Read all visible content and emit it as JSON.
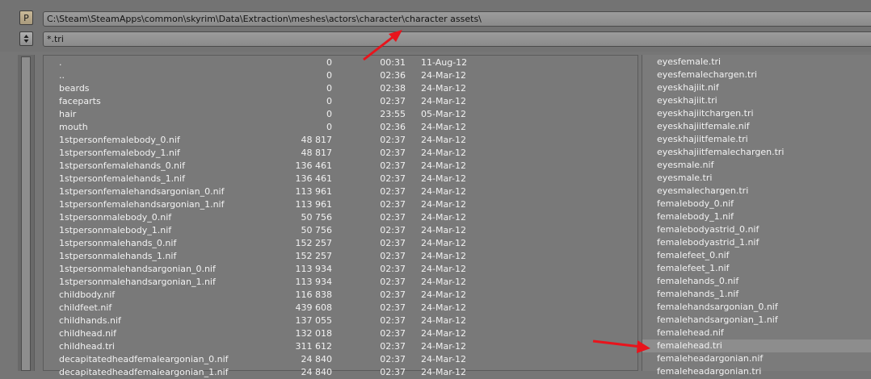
{
  "toolbar": {
    "parent_button_label": "P",
    "path": "C:\\Steam\\SteamApps\\common\\skyrim\\Data\\Extraction\\meshes\\actors\\character\\character assets\\",
    "filter": "*.tri"
  },
  "left_list": [
    {
      "name": ".",
      "size": "0",
      "time": "00:31",
      "date": "11-Aug-12"
    },
    {
      "name": "..",
      "size": "0",
      "time": "02:36",
      "date": "24-Mar-12"
    },
    {
      "name": "beards",
      "size": "0",
      "time": "02:38",
      "date": "24-Mar-12"
    },
    {
      "name": "faceparts",
      "size": "0",
      "time": "02:37",
      "date": "24-Mar-12"
    },
    {
      "name": "hair",
      "size": "0",
      "time": "23:55",
      "date": "05-Mar-12"
    },
    {
      "name": "mouth",
      "size": "0",
      "time": "02:36",
      "date": "24-Mar-12"
    },
    {
      "name": "1stpersonfemalebody_0.nif",
      "size": "48 817",
      "time": "02:37",
      "date": "24-Mar-12"
    },
    {
      "name": "1stpersonfemalebody_1.nif",
      "size": "48 817",
      "time": "02:37",
      "date": "24-Mar-12"
    },
    {
      "name": "1stpersonfemalehands_0.nif",
      "size": "136 461",
      "time": "02:37",
      "date": "24-Mar-12"
    },
    {
      "name": "1stpersonfemalehands_1.nif",
      "size": "136 461",
      "time": "02:37",
      "date": "24-Mar-12"
    },
    {
      "name": "1stpersonfemalehandsargonian_0.nif",
      "size": "113 961",
      "time": "02:37",
      "date": "24-Mar-12"
    },
    {
      "name": "1stpersonfemalehandsargonian_1.nif",
      "size": "113 961",
      "time": "02:37",
      "date": "24-Mar-12"
    },
    {
      "name": "1stpersonmalebody_0.nif",
      "size": "50 756",
      "time": "02:37",
      "date": "24-Mar-12"
    },
    {
      "name": "1stpersonmalebody_1.nif",
      "size": "50 756",
      "time": "02:37",
      "date": "24-Mar-12"
    },
    {
      "name": "1stpersonmalehands_0.nif",
      "size": "152 257",
      "time": "02:37",
      "date": "24-Mar-12"
    },
    {
      "name": "1stpersonmalehands_1.nif",
      "size": "152 257",
      "time": "02:37",
      "date": "24-Mar-12"
    },
    {
      "name": "1stpersonmalehandsargonian_0.nif",
      "size": "113 934",
      "time": "02:37",
      "date": "24-Mar-12"
    },
    {
      "name": "1stpersonmalehandsargonian_1.nif",
      "size": "113 934",
      "time": "02:37",
      "date": "24-Mar-12"
    },
    {
      "name": "childbody.nif",
      "size": "116 838",
      "time": "02:37",
      "date": "24-Mar-12"
    },
    {
      "name": "childfeet.nif",
      "size": "439 608",
      "time": "02:37",
      "date": "24-Mar-12"
    },
    {
      "name": "childhands.nif",
      "size": "137 055",
      "time": "02:37",
      "date": "24-Mar-12"
    },
    {
      "name": "childhead.nif",
      "size": "132 018",
      "time": "02:37",
      "date": "24-Mar-12"
    },
    {
      "name": "childhead.tri",
      "size": "311 612",
      "time": "02:37",
      "date": "24-Mar-12"
    },
    {
      "name": "decapitatedheadfemaleargonian_0.nif",
      "size": "24 840",
      "time": "02:37",
      "date": "24-Mar-12"
    },
    {
      "name": "decapitatedheadfemaleargonian_1.nif",
      "size": "24 840",
      "time": "02:37",
      "date": "24-Mar-12"
    }
  ],
  "right_list": [
    {
      "name": "eyesfemale.tri"
    },
    {
      "name": "eyesfemalechargen.tri"
    },
    {
      "name": "eyeskhajiit.nif"
    },
    {
      "name": "eyeskhajiit.tri"
    },
    {
      "name": "eyeskhajiitchargen.tri"
    },
    {
      "name": "eyeskhajiitfemale.nif"
    },
    {
      "name": "eyeskhajiitfemale.tri"
    },
    {
      "name": "eyeskhajiitfemalechargen.tri"
    },
    {
      "name": "eyesmale.nif"
    },
    {
      "name": "eyesmale.tri"
    },
    {
      "name": "eyesmalechargen.tri"
    },
    {
      "name": "femalebody_0.nif"
    },
    {
      "name": "femalebody_1.nif"
    },
    {
      "name": "femalebodyastrid_0.nif"
    },
    {
      "name": "femalebodyastrid_1.nif"
    },
    {
      "name": "femalefeet_0.nif"
    },
    {
      "name": "femalefeet_1.nif"
    },
    {
      "name": "femalehands_0.nif"
    },
    {
      "name": "femalehands_1.nif"
    },
    {
      "name": "femalehandsargonian_0.nif"
    },
    {
      "name": "femalehandsargonian_1.nif"
    },
    {
      "name": "femalehead.nif"
    },
    {
      "name": "femalehead.tri",
      "selected": true
    },
    {
      "name": "femaleheadargonian.nif"
    },
    {
      "name": "femaleheadargonian.tri"
    }
  ],
  "colors": {
    "annotation_arrow": "#e8141c"
  }
}
